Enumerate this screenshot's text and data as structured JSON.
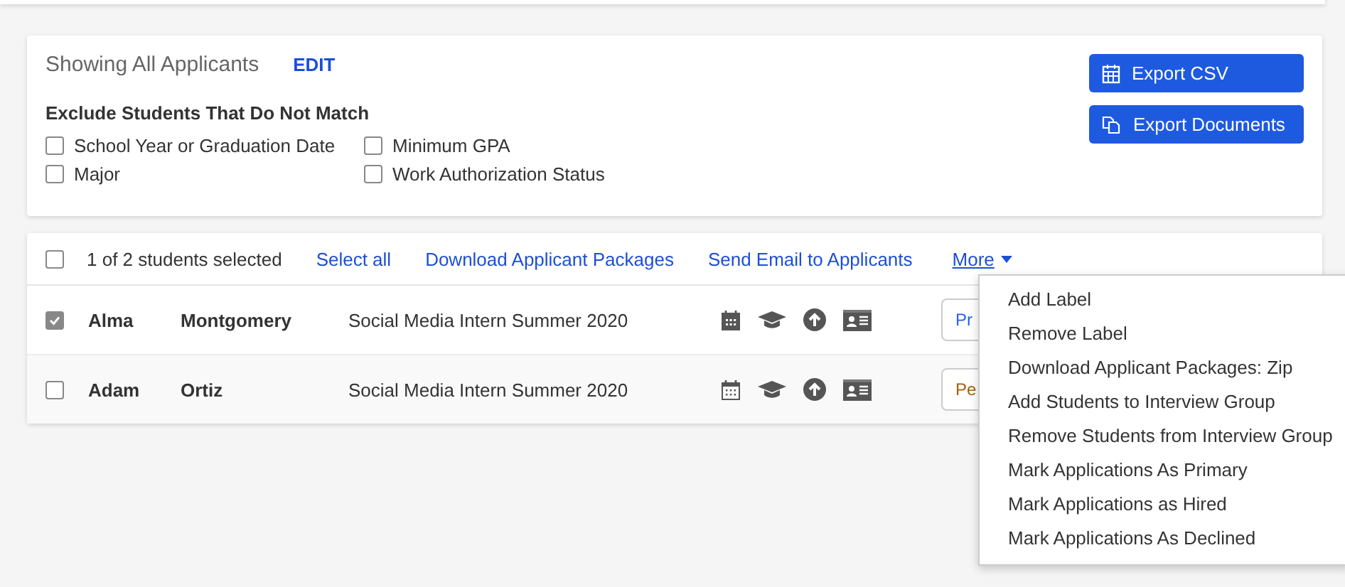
{
  "filter_card": {
    "title": "Showing All Applicants",
    "edit_link": "EDIT",
    "exclude_heading": "Exclude Students That Do Not Match",
    "filters": [
      {
        "label": "School Year or Graduation Date",
        "checked": false
      },
      {
        "label": "Minimum GPA",
        "checked": false
      },
      {
        "label": "Major",
        "checked": false
      },
      {
        "label": "Work Authorization Status",
        "checked": false
      }
    ],
    "buttons": [
      {
        "label": "Export CSV",
        "kind": "calendar"
      },
      {
        "label": "Export Documents",
        "kind": "documents"
      }
    ]
  },
  "list": {
    "select_all_checked": false,
    "selection_count": "1 of 2 students selected",
    "actions": [
      "Select all",
      "Download Applicant Packages",
      "Send Email to Applicants"
    ],
    "more": {
      "label": "More",
      "expanded": true
    },
    "rows": [
      {
        "first_name": "Alma",
        "last_name": "Montgomery",
        "job": "Social Media Intern Summer 2020",
        "selected": true,
        "scheduled": true,
        "status": "Pr",
        "color": "#2563eb"
      },
      {
        "first_name": "Adam",
        "last_name": "Ortiz",
        "job": "Social Media Intern Summer 2020",
        "selected": false,
        "scheduled": false,
        "status": "Pe",
        "color": "#a16207"
      }
    ]
  },
  "menu": {
    "items": [
      "Add Label",
      "Remove Label",
      "Download Applicant Packages: Zip",
      "Add Students to Interview Group",
      "Remove Students from Interview Group",
      "Mark Applications As Primary",
      "Mark Applications as Hired",
      "Mark Applications As Declined"
    ]
  }
}
